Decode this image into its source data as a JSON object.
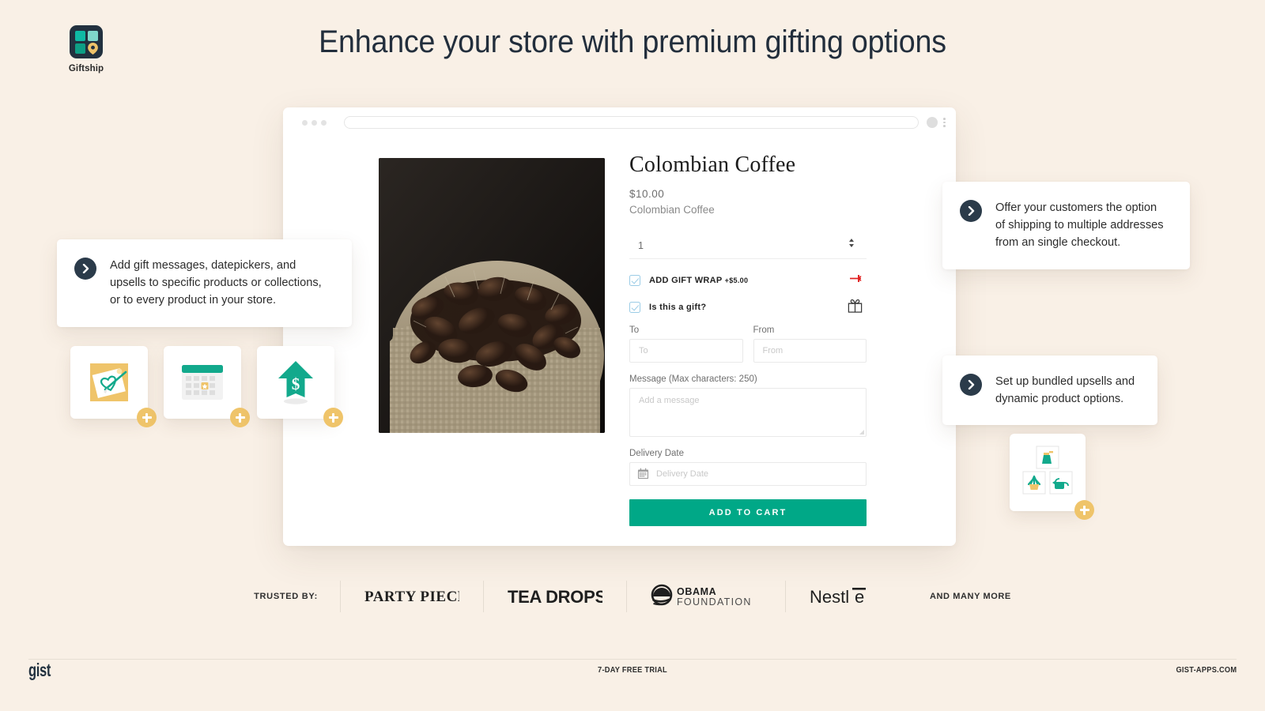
{
  "brand": {
    "name": "Giftship",
    "logo_icon": "giftship-grid-pin-logo",
    "dark": "#22313F",
    "teal": "#0FB9A4",
    "yellow": "#EFC46A"
  },
  "headline": "Enhance your store with premium gifting options",
  "browser": {
    "url_value": "",
    "dots_icon": "window-controls-icon",
    "avatar_icon": "profile-circle-icon",
    "menu_icon": "kebab-menu-icon"
  },
  "product": {
    "image_alt": "coffee-beans-in-burlap-sack",
    "title": "Colombian Coffee",
    "price": "$10.00",
    "variant": "Colombian Coffee",
    "quantity": "1",
    "gift_wrap": {
      "label": "ADD GIFT WRAP",
      "price": "+$5.00",
      "checked": true,
      "icon": "red-ribbon-icon"
    },
    "is_gift": {
      "label": "Is this a gift?",
      "checked": true,
      "icon": "gift-box-icon"
    },
    "to": {
      "label": "To",
      "value": "",
      "placeholder": "To"
    },
    "from": {
      "label": "From",
      "value": "",
      "placeholder": "From"
    },
    "message": {
      "label": "Message (Max characters: 250)",
      "value": "",
      "placeholder": "Add a message"
    },
    "delivery_date": {
      "label": "Delivery Date",
      "value": "",
      "placeholder": "Delivery Date",
      "icon": "calendar-icon"
    },
    "add_to_cart": "ADD TO CART",
    "accent": "#00A887"
  },
  "callouts": [
    {
      "id": "left",
      "text": "Add gift messages, datepickers, and upsells to specific products or collections, or to every product in your store.",
      "icon": "chevron-right-icon"
    },
    {
      "id": "right-1",
      "text": "Offer your customers the option of shipping to multiple addresses from an single checkout.",
      "icon": "chevron-right-icon"
    },
    {
      "id": "right-2",
      "text": "Set up bundled upsells and dynamic product options.",
      "icon": "chevron-right-icon"
    }
  ],
  "feature_cards": [
    {
      "id": "gift-message",
      "icon": "gift-card-heart-icon",
      "badge": "plus-badge"
    },
    {
      "id": "datepicker",
      "icon": "calendar-star-icon",
      "badge": "plus-badge"
    },
    {
      "id": "upsell",
      "icon": "arrow-up-dollar-icon",
      "badge": "plus-badge"
    },
    {
      "id": "bundle",
      "icon": "plant-bundle-icon",
      "badge": "plus-badge"
    }
  ],
  "trusted": {
    "label": "TRUSTED BY:",
    "logos": [
      "PARTY PIECES",
      "TEA DROPS",
      "OBAMA FOUNDATION",
      "Nestle"
    ],
    "and_more": "AND MANY MORE"
  },
  "footer": {
    "logo": "gist",
    "center": "7-DAY FREE TRIAL",
    "right": "GIST-APPS.COM"
  }
}
